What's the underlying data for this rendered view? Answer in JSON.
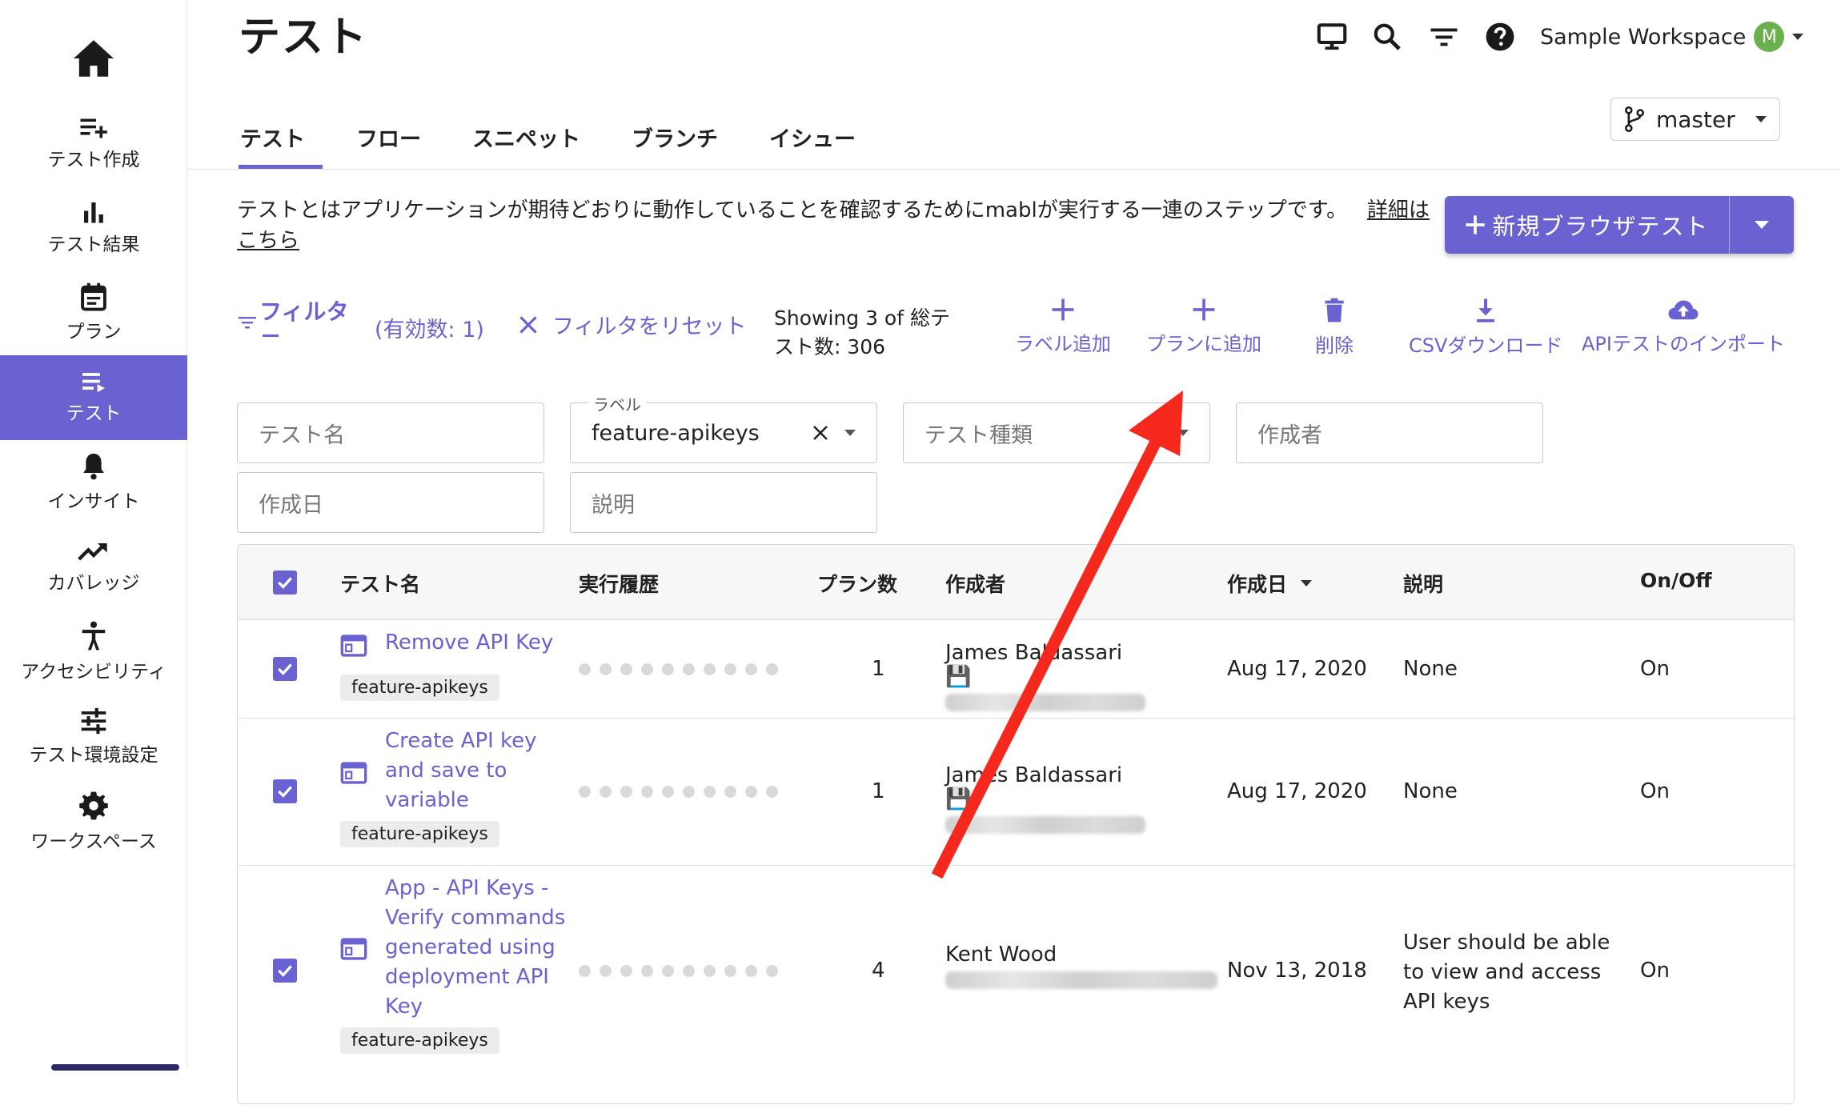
{
  "page": {
    "title": "テスト"
  },
  "header": {
    "icons": [
      "monitor-icon",
      "search-icon",
      "filter-list-icon",
      "help-icon"
    ],
    "workspace_name": "Sample Workspace",
    "avatar_initial": "M"
  },
  "sidebar": {
    "items": [
      {
        "label": "テスト作成",
        "icon": "add-list-icon"
      },
      {
        "label": "テスト結果",
        "icon": "bar-chart-icon"
      },
      {
        "label": "プラン",
        "icon": "calendar-icon"
      },
      {
        "label": "テスト",
        "icon": "list-icon",
        "active": true
      },
      {
        "label": "インサイト",
        "icon": "bell-icon"
      },
      {
        "label": "カバレッジ",
        "icon": "trending-icon"
      },
      {
        "label": "アクセシビリティ",
        "icon": "accessibility-icon"
      },
      {
        "label": "テスト環境設定",
        "icon": "sliders-icon"
      },
      {
        "label": "ワークスペース",
        "icon": "gear-icon"
      }
    ]
  },
  "tabs": [
    {
      "label": "テスト",
      "active": true
    },
    {
      "label": "フロー"
    },
    {
      "label": "スニペット"
    },
    {
      "label": "ブランチ"
    },
    {
      "label": "イシュー"
    }
  ],
  "branch": {
    "value": "master"
  },
  "description": {
    "text": "テストとはアプリケーションが期待どおりに動作していることを確認するためにmablが実行する一連のステップです。",
    "link": "詳細はこちら"
  },
  "new_test_button": {
    "label": "新規ブラウザテスト"
  },
  "toolbar": {
    "filter_label": "フィルタ",
    "active_count": "(有効数: 1)",
    "reset_label": "フィルタをリセット",
    "showing": "Showing 3 of 総テスト数: 306",
    "actions": [
      {
        "label": "ラベル追加",
        "icon": "plus-icon"
      },
      {
        "label": "プランに追加",
        "icon": "plus-icon"
      },
      {
        "label": "削除",
        "icon": "trash-icon"
      },
      {
        "label": "CSVダウンロード",
        "icon": "download-icon"
      },
      {
        "label": "APIテストのインポート",
        "icon": "cloud-upload-icon"
      }
    ]
  },
  "filters": {
    "test_name_placeholder": "テスト名",
    "label_caption": "ラベル",
    "label_value": "feature-apikeys",
    "test_type_placeholder": "テスト種類",
    "author_placeholder": "作成者",
    "created_placeholder": "作成日",
    "description_placeholder": "説明"
  },
  "table": {
    "columns": [
      "テスト名",
      "実行履歴",
      "プラン数",
      "作成者",
      "作成日",
      "説明",
      "On/Off"
    ],
    "rows": [
      {
        "name": "Remove API Key",
        "tag": "feature-apikeys",
        "plans": "1",
        "author": "James Baldassari",
        "created": "Aug 17, 2020",
        "description": "None",
        "state": "On"
      },
      {
        "name": "Create API key and save to variable",
        "tag": "feature-apikeys",
        "plans": "1",
        "author": "James Baldassari",
        "created": "Aug 17, 2020",
        "description": "None",
        "state": "On"
      },
      {
        "name": "App - API Keys - Verify commands generated using deployment API Key",
        "tag": "feature-apikeys",
        "plans": "4",
        "author": "Kent Wood",
        "created": "Nov 13, 2018",
        "description": "User should be able to view and access API keys",
        "state": "On"
      }
    ]
  },
  "colors": {
    "accent": "#6a62d0",
    "arrow": "#f5281d",
    "avatar": "#6ab04c"
  }
}
